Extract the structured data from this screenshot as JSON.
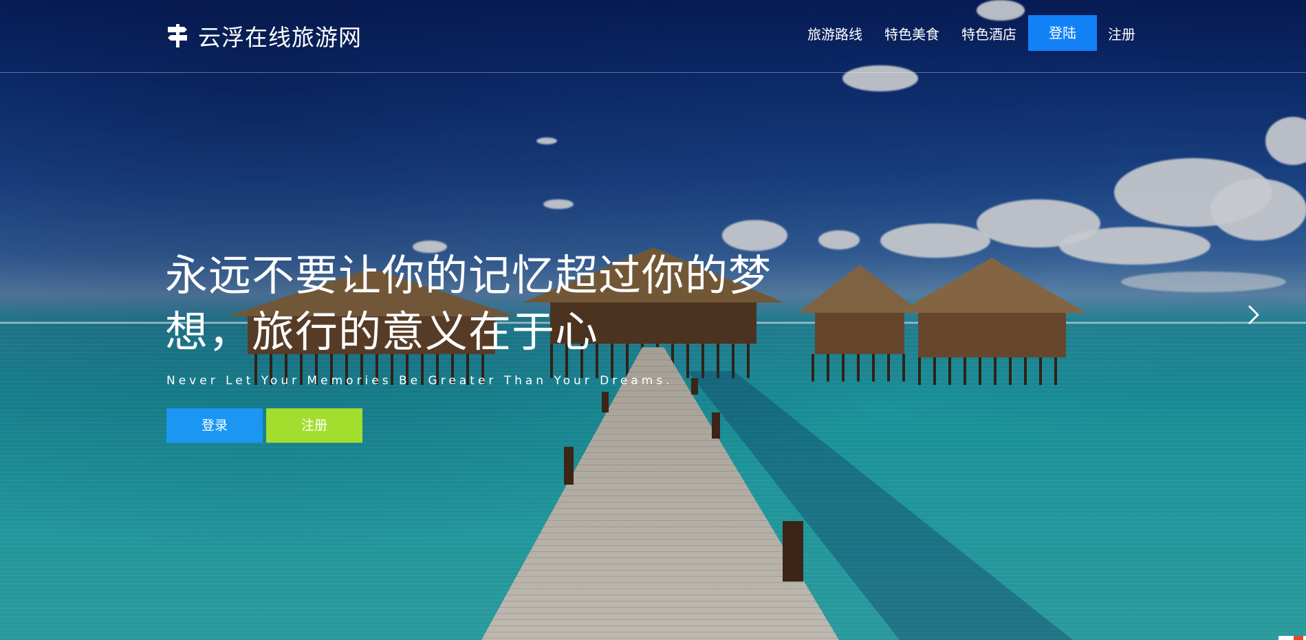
{
  "brand": {
    "icon": "signpost-icon",
    "name": "云浮在线旅游网"
  },
  "nav": {
    "items": [
      "旅游路线",
      "特色美食",
      "特色酒店"
    ],
    "login_label": "登陆",
    "register_label": "注册"
  },
  "hero": {
    "headline_line1": "永远不要让你的记忆超过你的梦",
    "headline_line2": "想，旅行的意义在于心",
    "subline": "Never Let Your Memories Be Greater Than Your Dreams.",
    "login_button": "登录",
    "register_button": "注册",
    "next_icon": "chevron-right-icon"
  },
  "colors": {
    "nav_login_bg": "#1281f6",
    "cta_login_bg": "#1b96f3",
    "cta_register_bg": "#a3de2f"
  }
}
